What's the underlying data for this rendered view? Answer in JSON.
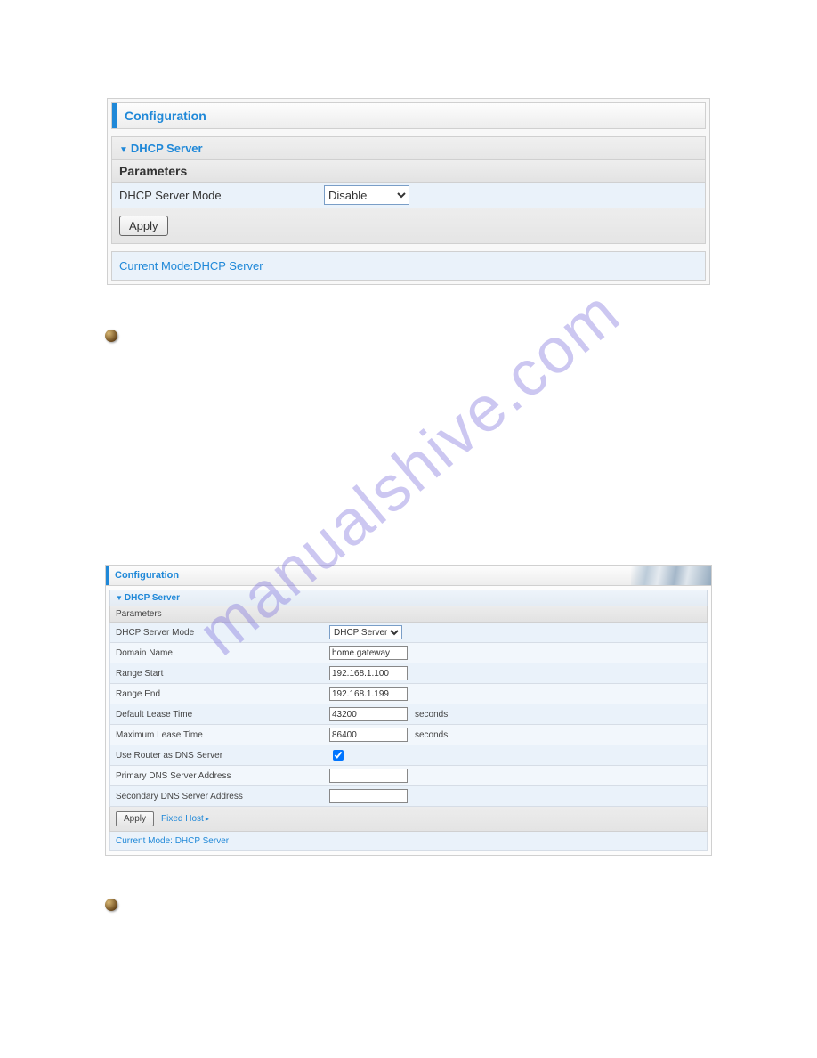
{
  "watermark": "manualshive.com",
  "panel1": {
    "title": "Configuration",
    "section": "DHCP Server",
    "parameters_heading": "Parameters",
    "mode_label": "DHCP Server Mode",
    "mode_value": "Disable",
    "apply_label": "Apply",
    "current_mode": "Current Mode:DHCP Server"
  },
  "panel2": {
    "title": "Configuration",
    "section": "DHCP Server",
    "parameters_heading": "Parameters",
    "rows": {
      "mode": {
        "label": "DHCP Server Mode",
        "value": "DHCP Server"
      },
      "domain": {
        "label": "Domain Name",
        "value": "home.gateway"
      },
      "range_start": {
        "label": "Range Start",
        "value": "192.168.1.100"
      },
      "range_end": {
        "label": "Range End",
        "value": "192.168.1.199"
      },
      "default_lease": {
        "label": "Default Lease Time",
        "value": "43200",
        "unit": "seconds"
      },
      "max_lease": {
        "label": "Maximum Lease Time",
        "value": "86400",
        "unit": "seconds"
      },
      "use_router_dns": {
        "label": "Use Router as DNS Server",
        "checked": true
      },
      "primary_dns": {
        "label": "Primary DNS Server Address",
        "value": ""
      },
      "secondary_dns": {
        "label": "Secondary DNS Server Address",
        "value": ""
      }
    },
    "apply_label": "Apply",
    "fixed_host_label": "Fixed Host",
    "current_mode": "Current Mode: DHCP Server"
  }
}
